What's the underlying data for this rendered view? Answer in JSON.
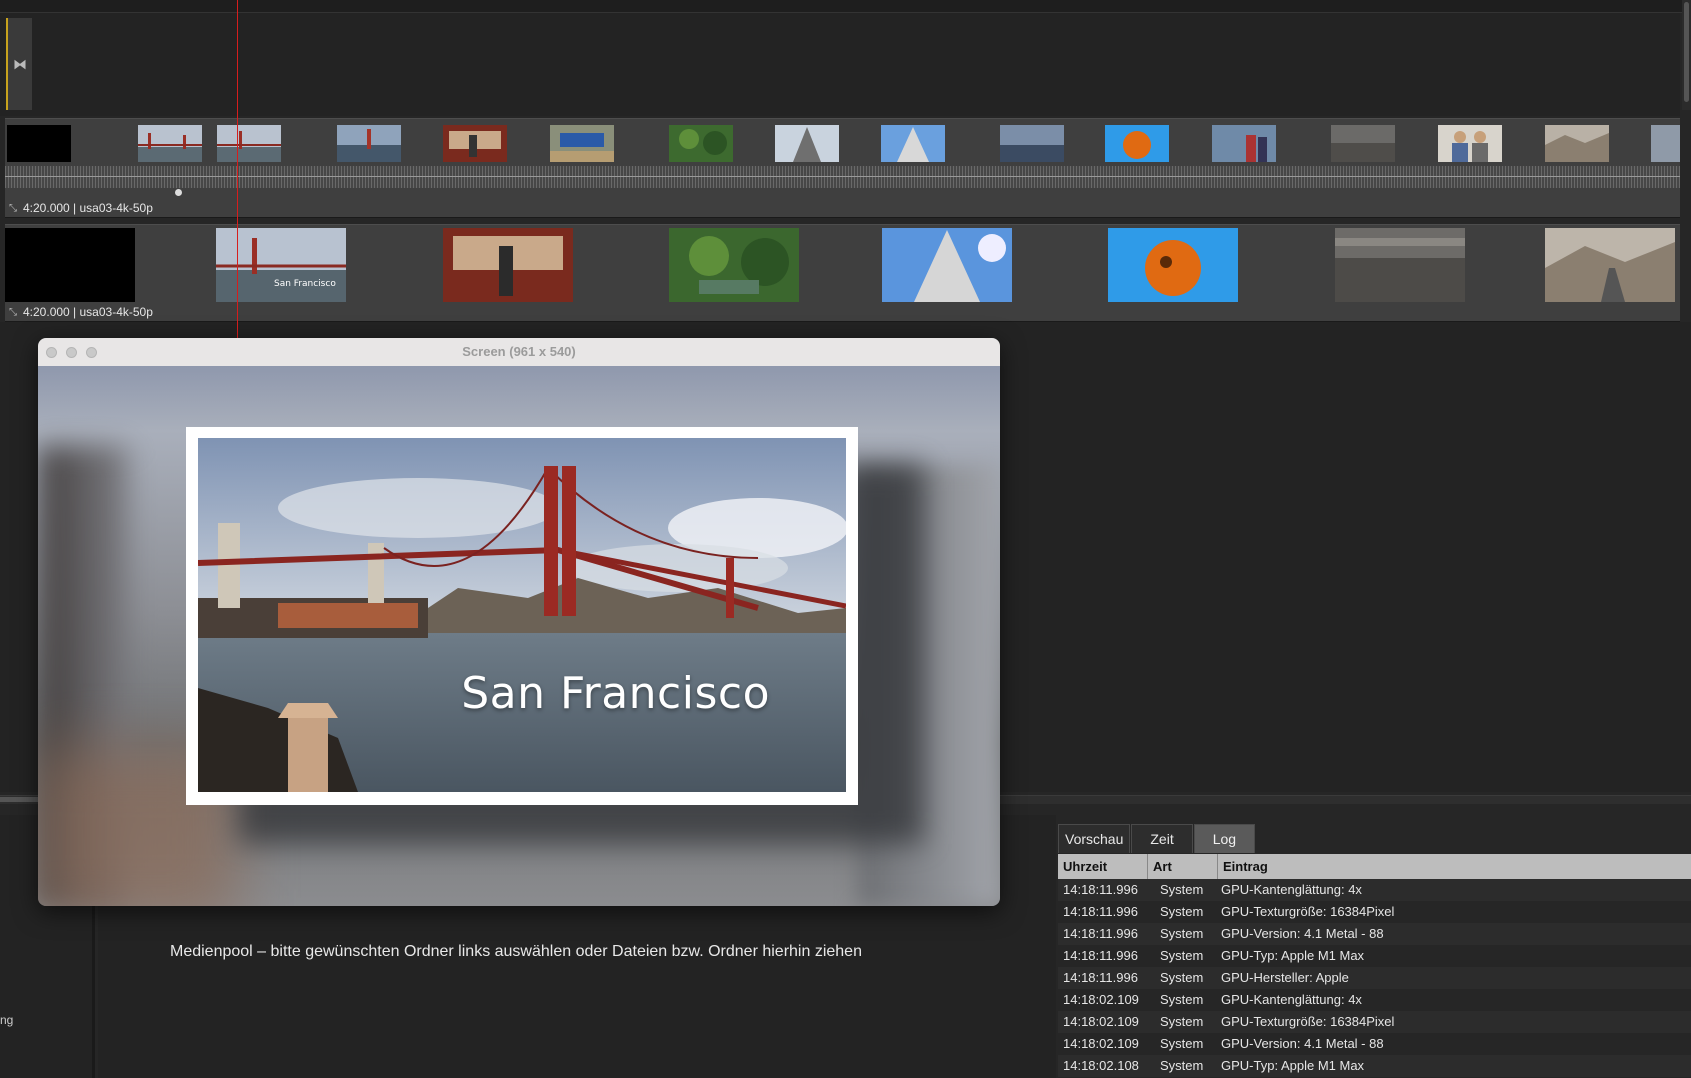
{
  "timeline": {
    "track1_label": "4:20.000 | usa03-4k-50p",
    "track2_label": "4:20.000 | usa03-4k-50p",
    "marker_glyph": "⧓",
    "small_clip_count": 15,
    "big_clip_count": 8
  },
  "screen_window": {
    "title": "Screen (961 x 540)",
    "photo_title": "San Francisco"
  },
  "left_panel": {
    "fragment_1": "",
    "fragment_2": "ng"
  },
  "media_pool": {
    "hint": "Medienpool – bitte gewünschten Ordner links auswählen oder Dateien bzw. Ordner hierhin ziehen"
  },
  "log_panel": {
    "tabs": [
      {
        "label": "Vorschau"
      },
      {
        "label": "Zeit"
      },
      {
        "label": "Log"
      }
    ],
    "columns": {
      "time": "Uhrzeit",
      "type": "Art",
      "entry": "Eintrag"
    },
    "rows": [
      {
        "time": "14:18:11.996",
        "type": "System",
        "entry": "GPU-Kantenglättung: 4x"
      },
      {
        "time": "14:18:11.996",
        "type": "System",
        "entry": "GPU-Texturgröße: 16384Pixel"
      },
      {
        "time": "14:18:11.996",
        "type": "System",
        "entry": "GPU-Version: 4.1 Metal - 88"
      },
      {
        "time": "14:18:11.996",
        "type": "System",
        "entry": "GPU-Typ: Apple M1 Max"
      },
      {
        "time": "14:18:11.996",
        "type": "System",
        "entry": "GPU-Hersteller: Apple"
      },
      {
        "time": "14:18:02.109",
        "type": "System",
        "entry": "GPU-Kantenglättung: 4x"
      },
      {
        "time": "14:18:02.109",
        "type": "System",
        "entry": "GPU-Texturgröße: 16384Pixel"
      },
      {
        "time": "14:18:02.109",
        "type": "System",
        "entry": "GPU-Version: 4.1 Metal - 88"
      },
      {
        "time": "14:18:02.108",
        "type": "System",
        "entry": "GPU-Typ: Apple M1 Max"
      }
    ]
  },
  "colors": {
    "playhead": "#d61d1d",
    "marker_accent": "#c7a21d",
    "active_tab": "#5a5a5a"
  }
}
